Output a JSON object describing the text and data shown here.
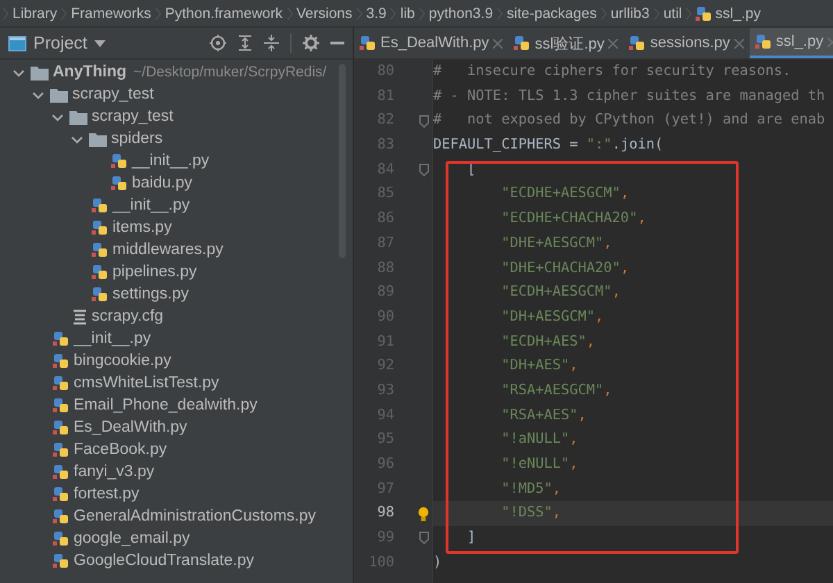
{
  "breadcrumbs": [
    {
      "label": "Library",
      "kind": "folder"
    },
    {
      "label": "Frameworks",
      "kind": "folder"
    },
    {
      "label": "Python.framework",
      "kind": "folder"
    },
    {
      "label": "Versions",
      "kind": "folder"
    },
    {
      "label": "3.9",
      "kind": "folder"
    },
    {
      "label": "lib",
      "kind": "folder"
    },
    {
      "label": "python3.9",
      "kind": "folder"
    },
    {
      "label": "site-packages",
      "kind": "folder"
    },
    {
      "label": "urllib3",
      "kind": "folder"
    },
    {
      "label": "util",
      "kind": "folder"
    },
    {
      "label": "ssl_.py",
      "kind": "python"
    }
  ],
  "project_panel": {
    "title": "Project",
    "tree": [
      {
        "label": "AnyThing",
        "path": "~/Desktop/muker/ScrpyRedis/",
        "kind": "folder",
        "expanded": true,
        "children": [
          {
            "label": "scrapy_test",
            "kind": "folder",
            "expanded": true,
            "children": [
              {
                "label": "scrapy_test",
                "kind": "folder",
                "expanded": true,
                "children": [
                  {
                    "label": "spiders",
                    "kind": "folder",
                    "expanded": true,
                    "children": [
                      {
                        "label": "__init__.py",
                        "kind": "python"
                      },
                      {
                        "label": "baidu.py",
                        "kind": "python"
                      }
                    ]
                  },
                  {
                    "label": "__init__.py",
                    "kind": "python"
                  },
                  {
                    "label": "items.py",
                    "kind": "python"
                  },
                  {
                    "label": "middlewares.py",
                    "kind": "python"
                  },
                  {
                    "label": "pipelines.py",
                    "kind": "python"
                  },
                  {
                    "label": "settings.py",
                    "kind": "python"
                  }
                ]
              },
              {
                "label": "scrapy.cfg",
                "kind": "config"
              }
            ]
          },
          {
            "label": "__init__.py",
            "kind": "python"
          },
          {
            "label": "bingcookie.py",
            "kind": "python"
          },
          {
            "label": "cmsWhiteListTest.py",
            "kind": "python"
          },
          {
            "label": "Email_Phone_dealwith.py",
            "kind": "python"
          },
          {
            "label": "Es_DealWith.py",
            "kind": "python"
          },
          {
            "label": "FaceBook.py",
            "kind": "python"
          },
          {
            "label": "fanyi_v3.py",
            "kind": "python"
          },
          {
            "label": "fortest.py",
            "kind": "python"
          },
          {
            "label": "GeneralAdministrationCustoms.py",
            "kind": "python"
          },
          {
            "label": "google_email.py",
            "kind": "python"
          },
          {
            "label": "GoogleCloudTranslate.py",
            "kind": "python"
          }
        ]
      }
    ]
  },
  "tabs": [
    {
      "label": "Es_DealWith.py",
      "selected": false
    },
    {
      "label": "ssl验证.py",
      "selected": false
    },
    {
      "label": "sessions.py",
      "selected": false
    },
    {
      "label": "ssl_.py",
      "selected": true
    }
  ],
  "editor": {
    "lines": [
      {
        "number": "80",
        "boxed": false,
        "current": false,
        "fold": false,
        "hint": false,
        "segments": [
          {
            "kind": "comment",
            "text": "#   insecure ciphers for security reasons."
          }
        ]
      },
      {
        "number": "81",
        "boxed": false,
        "current": false,
        "fold": false,
        "hint": false,
        "segments": [
          {
            "kind": "comment",
            "text": "# - NOTE: TLS 1.3 cipher suites are managed th"
          }
        ]
      },
      {
        "number": "82",
        "boxed": false,
        "current": false,
        "fold": true,
        "hint": false,
        "segments": [
          {
            "kind": "comment",
            "text": "#   not exposed by CPython (yet!) and are enab"
          }
        ]
      },
      {
        "number": "83",
        "boxed": false,
        "current": false,
        "fold": false,
        "hint": false,
        "segments": [
          {
            "kind": "plain",
            "text": "DEFAULT_CIPHERS = "
          },
          {
            "kind": "string",
            "text": "\":\""
          },
          {
            "kind": "plain",
            "text": ".join("
          }
        ]
      },
      {
        "number": "84",
        "boxed": true,
        "current": false,
        "fold": true,
        "hint": false,
        "segments": [
          {
            "kind": "plain",
            "text": "    ["
          }
        ]
      },
      {
        "number": "85",
        "boxed": true,
        "current": false,
        "fold": false,
        "hint": false,
        "segments": [
          {
            "kind": "string",
            "text": "        \"ECDHE+AESGCM\""
          },
          {
            "kind": "punct",
            "text": ","
          }
        ]
      },
      {
        "number": "86",
        "boxed": true,
        "current": false,
        "fold": false,
        "hint": false,
        "segments": [
          {
            "kind": "string",
            "text": "        \"ECDHE+CHACHA20\""
          },
          {
            "kind": "punct",
            "text": ","
          }
        ]
      },
      {
        "number": "87",
        "boxed": true,
        "current": false,
        "fold": false,
        "hint": false,
        "segments": [
          {
            "kind": "string",
            "text": "        \"DHE+AESGCM\""
          },
          {
            "kind": "punct",
            "text": ","
          }
        ]
      },
      {
        "number": "88",
        "boxed": true,
        "current": false,
        "fold": false,
        "hint": false,
        "segments": [
          {
            "kind": "string",
            "text": "        \"DHE+CHACHA20\""
          },
          {
            "kind": "punct",
            "text": ","
          }
        ]
      },
      {
        "number": "89",
        "boxed": true,
        "current": false,
        "fold": false,
        "hint": false,
        "segments": [
          {
            "kind": "string",
            "text": "        \"ECDH+AESGCM\""
          },
          {
            "kind": "punct",
            "text": ","
          }
        ]
      },
      {
        "number": "90",
        "boxed": true,
        "current": false,
        "fold": false,
        "hint": false,
        "segments": [
          {
            "kind": "string",
            "text": "        \"DH+AESGCM\""
          },
          {
            "kind": "punct",
            "text": ","
          }
        ]
      },
      {
        "number": "91",
        "boxed": true,
        "current": false,
        "fold": false,
        "hint": false,
        "segments": [
          {
            "kind": "string",
            "text": "        \"ECDH+AES\""
          },
          {
            "kind": "punct",
            "text": ","
          }
        ]
      },
      {
        "number": "92",
        "boxed": true,
        "current": false,
        "fold": false,
        "hint": false,
        "segments": [
          {
            "kind": "string",
            "text": "        \"DH+AES\""
          },
          {
            "kind": "punct",
            "text": ","
          }
        ]
      },
      {
        "number": "93",
        "boxed": true,
        "current": false,
        "fold": false,
        "hint": false,
        "segments": [
          {
            "kind": "string",
            "text": "        \"RSA+AESGCM\""
          },
          {
            "kind": "punct",
            "text": ","
          }
        ]
      },
      {
        "number": "94",
        "boxed": true,
        "current": false,
        "fold": false,
        "hint": false,
        "segments": [
          {
            "kind": "string",
            "text": "        \"RSA+AES\""
          },
          {
            "kind": "punct",
            "text": ","
          }
        ]
      },
      {
        "number": "95",
        "boxed": true,
        "current": false,
        "fold": false,
        "hint": false,
        "segments": [
          {
            "kind": "string",
            "text": "        \"!aNULL\""
          },
          {
            "kind": "punct",
            "text": ","
          }
        ]
      },
      {
        "number": "96",
        "boxed": true,
        "current": false,
        "fold": false,
        "hint": false,
        "segments": [
          {
            "kind": "string",
            "text": "        \"!eNULL\""
          },
          {
            "kind": "punct",
            "text": ","
          }
        ]
      },
      {
        "number": "97",
        "boxed": true,
        "current": false,
        "fold": false,
        "hint": false,
        "segments": [
          {
            "kind": "string",
            "text": "        \"!MD5\""
          },
          {
            "kind": "punct",
            "text": ","
          }
        ]
      },
      {
        "number": "98",
        "boxed": true,
        "current": true,
        "fold": false,
        "hint": true,
        "segments": [
          {
            "kind": "string",
            "text": "        \"!DSS\""
          },
          {
            "kind": "punct",
            "text": ","
          }
        ]
      },
      {
        "number": "99",
        "boxed": true,
        "current": false,
        "fold": true,
        "hint": false,
        "segments": [
          {
            "kind": "plain",
            "text": "    ]"
          }
        ]
      },
      {
        "number": "100",
        "boxed": false,
        "current": false,
        "fold": false,
        "hint": false,
        "segments": [
          {
            "kind": "plain",
            "text": ")"
          }
        ]
      }
    ]
  }
}
